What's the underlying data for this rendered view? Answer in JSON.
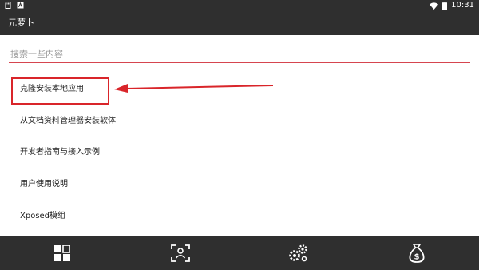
{
  "status_bar": {
    "time": "10:31",
    "icons": [
      "sd-card-icon",
      "a-notification-icon",
      "wifi-icon",
      "battery-icon"
    ]
  },
  "app": {
    "title": "元萝卜"
  },
  "search": {
    "placeholder": "搜索一些内容",
    "value": ""
  },
  "list_items": [
    {
      "label": "克隆安装本地应用"
    },
    {
      "label": "从文档资料管理器安装软体"
    },
    {
      "label": "开发者指南与接入示例"
    },
    {
      "label": "用户使用说明"
    },
    {
      "label": "Xposed模组"
    }
  ],
  "annotation": {
    "color": "#d9252a"
  },
  "bottom_nav": {
    "items": [
      "apps-grid-icon",
      "user-profile-icon",
      "settings-gears-icon",
      "money-bag-icon"
    ]
  },
  "colors": {
    "bar": "#2f2f2f",
    "accent": "#d6454f"
  }
}
